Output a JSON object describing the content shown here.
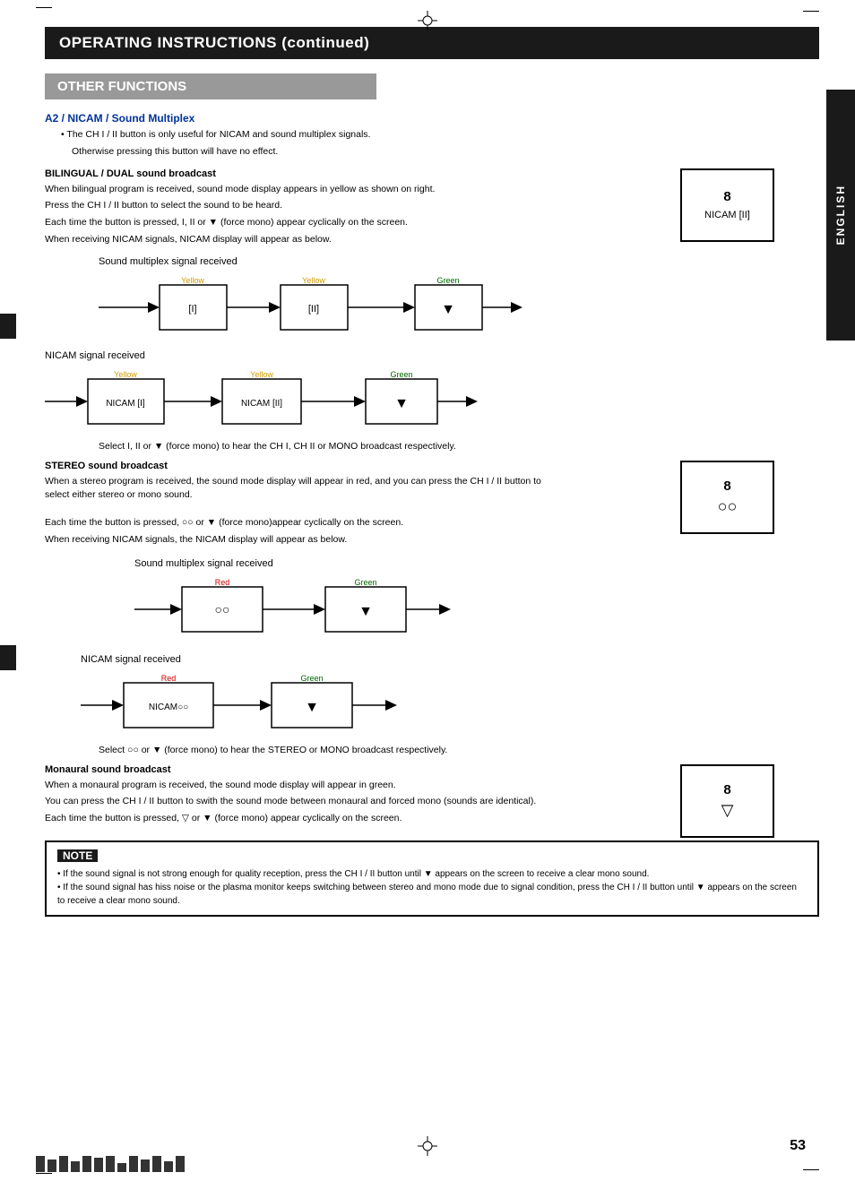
{
  "header": {
    "title": "OPERATING INSTRUCTIONS (continued)"
  },
  "section": {
    "title": "OTHER FUNCTIONS"
  },
  "sidebar": {
    "label": "ENGLISH"
  },
  "subsections": {
    "a2nicam": {
      "title": "A2 / NICAM / Sound Multiplex",
      "bullets": [
        "The CH I / II button is only useful for NICAM and sound multiplex signals.",
        "Otherwise pressing this button will have no effect."
      ]
    },
    "bilingual": {
      "title": "BILINGUAL / DUAL sound broadcast",
      "body1": "When bilingual program is received, sound mode display appears in yellow as shown on right.",
      "body2": "Press the CH I / II button to select the sound to be heard.",
      "body3": "Each time the button is pressed, I, II or ▼ (force mono) appear cyclically on the screen.",
      "body4": "When receiving NICAM signals, NICAM display will appear as below."
    },
    "stereo": {
      "title": "STEREO sound broadcast",
      "body1": "When a stereo program is received, the sound mode display will appear in red, and you can press the CH I / II button to select either stereo or mono sound.",
      "body2": "Each time the button is pressed, ○○ or ▼ (force mono)appear cyclically on the screen.",
      "body3": "When receiving NICAM signals, the NICAM display will appear as below."
    },
    "monaural": {
      "title": "Monaural sound broadcast",
      "body1": "When a monaural program is received, the sound mode display will appear in green.",
      "body2": "You can press the CH I / II button to swith the sound mode between monaural and forced mono (sounds are identical).",
      "body3": "Each time the button is pressed, ▽ or ▼ (force mono) appear cyclically on the screen."
    }
  },
  "diagrams": {
    "sound_multiplex_1": {
      "label": "Sound multiplex signal received",
      "boxes": [
        "[I]",
        "[II]",
        "▼"
      ],
      "colors": [
        "Yellow",
        "Yellow",
        "Green"
      ]
    },
    "nicam_1": {
      "label": "NICAM signal received",
      "boxes": [
        "NICAM [I]",
        "NICAM [II]",
        "▼"
      ],
      "colors": [
        "Yellow",
        "Yellow",
        "Green"
      ]
    },
    "select_text_1": "Select  I,  II or  ▼ (force mono) to hear the CH I, CH II or MONO broadcast respectively.",
    "sound_multiplex_2": {
      "label": "Sound multiplex signal received",
      "boxes": [
        "○○",
        "▼"
      ],
      "colors": [
        "Red",
        "Green"
      ]
    },
    "nicam_2": {
      "label": "NICAM signal received",
      "boxes": [
        "NICAM○○",
        "▼"
      ],
      "colors": [
        "Red",
        "Green"
      ]
    },
    "select_text_2": "Select ○○ or ▼ (force mono) to hear the STEREO or MONO broadcast respectively."
  },
  "monitors": {
    "bilingual": {
      "number": "8",
      "label": "NICAM [II]"
    },
    "stereo": {
      "number": "8",
      "symbol": "○○"
    },
    "monaural": {
      "number": "8",
      "symbol": "▽"
    }
  },
  "note": {
    "title": "NOTE",
    "bullets": [
      "If the sound signal is not strong enough for quality reception, press the CH I / II button until ▼ appears on the screen to receive a clear mono sound.",
      "If the sound signal has hiss noise or the plasma monitor keeps switching between stereo and mono mode due to signal condition, press the CH I / II button until ▼ appears on the screen to receive a clear mono sound."
    ]
  },
  "page_number": "53"
}
